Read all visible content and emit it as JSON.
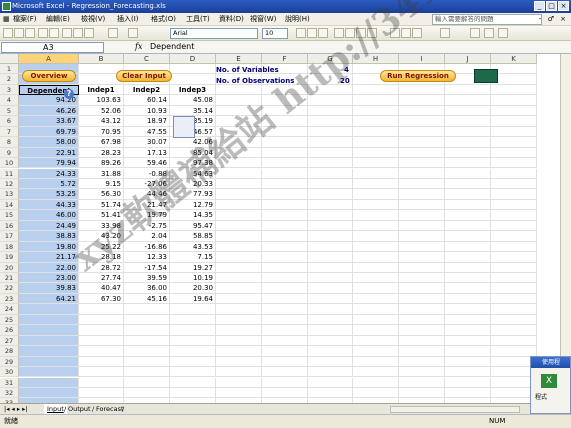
{
  "window": {
    "title": "Microsoft Excel - Regression_Forecasting.xls",
    "controls": [
      "_",
      "□",
      "×"
    ]
  },
  "menu": {
    "items": [
      "檔案(F)",
      "編輯(E)",
      "檢視(V)",
      "插入(I)",
      "格式(O)",
      "工具(T)",
      "資料(D)",
      "視窗(W)",
      "說明(H)"
    ],
    "help_placeholder": "輸入需要解答的問題",
    "doc_controls": "- ♂ ×"
  },
  "toolbar": {
    "font": "Arial",
    "size": "10"
  },
  "formula_bar": {
    "name_box": "A3",
    "fx": "fx",
    "content": "Dependent"
  },
  "columns": [
    "A",
    "B",
    "C",
    "D",
    "E",
    "F",
    "G",
    "H",
    "I",
    "J",
    "K"
  ],
  "buttons": {
    "overview": "Overview",
    "clear_input": "Clear Input",
    "run_regression": "Run Regression"
  },
  "stats": {
    "vars_label": "No. of Variables",
    "vars_value": "4",
    "obs_label": "No. of Observations",
    "obs_value": "20"
  },
  "table": {
    "headers": [
      "Dependent",
      "Indep1",
      "Indep2",
      "Indep3"
    ],
    "rows": [
      [
        "94.20",
        "103.63",
        "60.14",
        "45.08"
      ],
      [
        "46.26",
        "52.06",
        "10.93",
        "35.14"
      ],
      [
        "33.67",
        "43.12",
        "18.97",
        "35.19"
      ],
      [
        "69.79",
        "70.95",
        "47.55",
        "46.57"
      ],
      [
        "58.00",
        "67.98",
        "30.07",
        "42.06"
      ],
      [
        "22.91",
        "28.23",
        "17.13",
        "85.04"
      ],
      [
        "79.94",
        "89.26",
        "59.46",
        "97.38"
      ],
      [
        "24.33",
        "31.88",
        "-0.88",
        "54.63"
      ],
      [
        "5.72",
        "9.15",
        "-27.06",
        "20.33"
      ],
      [
        "53.25",
        "56.30",
        "44.46",
        "77.93"
      ],
      [
        "44.33",
        "51.74",
        "21.47",
        "12.79"
      ],
      [
        "46.00",
        "51.41",
        "19.79",
        "14.35"
      ],
      [
        "24.49",
        "33.98",
        "-2.75",
        "95.47"
      ],
      [
        "38.83",
        "43.20",
        "2.04",
        "58.85"
      ],
      [
        "19.80",
        "25.22",
        "-16.86",
        "43.53"
      ],
      [
        "21.17",
        "28.18",
        "12.33",
        "7.15"
      ],
      [
        "22.00",
        "28.72",
        "-17.54",
        "19.27"
      ],
      [
        "23.00",
        "27.74",
        "39.59",
        "10.19"
      ],
      [
        "39.83",
        "40.47",
        "36.00",
        "20.30"
      ],
      [
        "64.21",
        "67.30",
        "45.16",
        "19.64"
      ]
    ]
  },
  "sheet_tabs": [
    "Input",
    "Output",
    "Forecast"
  ],
  "status": {
    "left": "就緒",
    "right": "NUM"
  },
  "notification": {
    "title": "使用程",
    "body": "程式"
  },
  "watermark": "xyz軟體補給站 http://341.to",
  "colors": {
    "title_bar": "#1a3f9a",
    "selected_column": "#b8d0ee",
    "button_fill": "#f2b733",
    "stat_text": "#00007a"
  }
}
